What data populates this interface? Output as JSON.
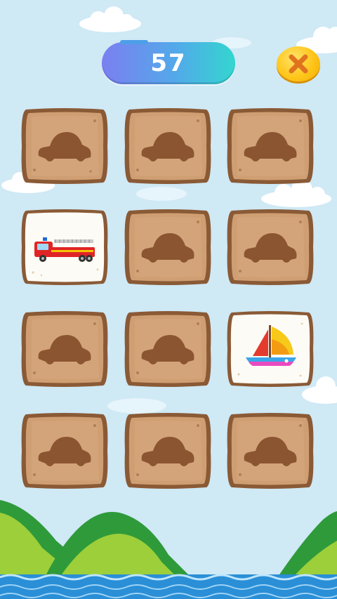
{
  "hud": {
    "score": "57",
    "close_icon": "close-x-icon"
  },
  "board": {
    "rows": 4,
    "cols": 3,
    "cards": [
      {
        "state": "hidden",
        "icon": "car-silhouette-icon"
      },
      {
        "state": "hidden",
        "icon": "car-silhouette-icon"
      },
      {
        "state": "hidden",
        "icon": "car-silhouette-icon"
      },
      {
        "state": "revealed",
        "icon": "fire-truck-icon"
      },
      {
        "state": "hidden",
        "icon": "car-silhouette-icon"
      },
      {
        "state": "hidden",
        "icon": "car-silhouette-icon"
      },
      {
        "state": "hidden",
        "icon": "car-silhouette-icon"
      },
      {
        "state": "hidden",
        "icon": "car-silhouette-icon"
      },
      {
        "state": "revealed",
        "icon": "sailboat-icon"
      },
      {
        "state": "hidden",
        "icon": "car-silhouette-icon"
      },
      {
        "state": "hidden",
        "icon": "car-silhouette-icon"
      },
      {
        "state": "hidden",
        "icon": "car-silhouette-icon"
      }
    ]
  },
  "colors": {
    "sky": "#cfe9f5",
    "card_back": "#cf9f73",
    "card_border": "#8a5a36",
    "card_face": "#fdfbf5",
    "silhouette": "#8c5532",
    "hill": "#2f9a3a",
    "water": "#2a8fd6"
  }
}
